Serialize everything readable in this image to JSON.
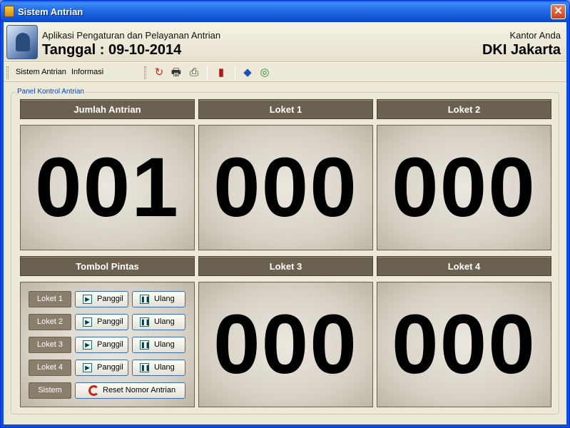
{
  "window": {
    "title": "Sistem Antrian",
    "close_label": "✕"
  },
  "header": {
    "subtitle": "Aplikasi Pengaturan dan Pelayanan Antrian",
    "date": "Tanggal : 09-10-2014",
    "office_label": "Kantor Anda",
    "office_city": "DKI Jakarta"
  },
  "menu": {
    "items": [
      "Sistem Antrian",
      "Informasi"
    ]
  },
  "toolbar": {
    "icons": [
      "refresh-icon",
      "printer-icon",
      "print-setup-icon",
      "exit-door-icon",
      "book-icon",
      "target-icon"
    ],
    "glyphs": [
      "↻",
      "🖶",
      "⎙",
      "▮",
      "◆",
      "◎"
    ],
    "colors": [
      "#c0281e",
      "#333333",
      "#333333",
      "#b01818",
      "#1f4fb8",
      "#2e8b2e"
    ]
  },
  "panel": {
    "legend": "Panel Kontrol Antrian",
    "cells": [
      {
        "header": "Jumlah Antrian",
        "value": "001"
      },
      {
        "header": "Loket 1",
        "value": "000"
      },
      {
        "header": "Loket 2",
        "value": "000"
      },
      {
        "header": "Tombol Pintas",
        "value": ""
      },
      {
        "header": "Loket 3",
        "value": "000"
      },
      {
        "header": "Loket 4",
        "value": "000"
      }
    ],
    "shortcuts": [
      {
        "label": "Loket 1",
        "call": "Panggil",
        "repeat": "Ulang"
      },
      {
        "label": "Loket 2",
        "call": "Panggil",
        "repeat": "Ulang"
      },
      {
        "label": "Loket 3",
        "call": "Panggil",
        "repeat": "Ulang"
      },
      {
        "label": "Loket 4",
        "call": "Panggil",
        "repeat": "Ulang"
      }
    ],
    "system_label": "Sistem",
    "reset_label": "Reset Nomor Antrian"
  },
  "colors": {
    "header_bar": "#6b6150",
    "accent_blue": "#0046d5"
  }
}
